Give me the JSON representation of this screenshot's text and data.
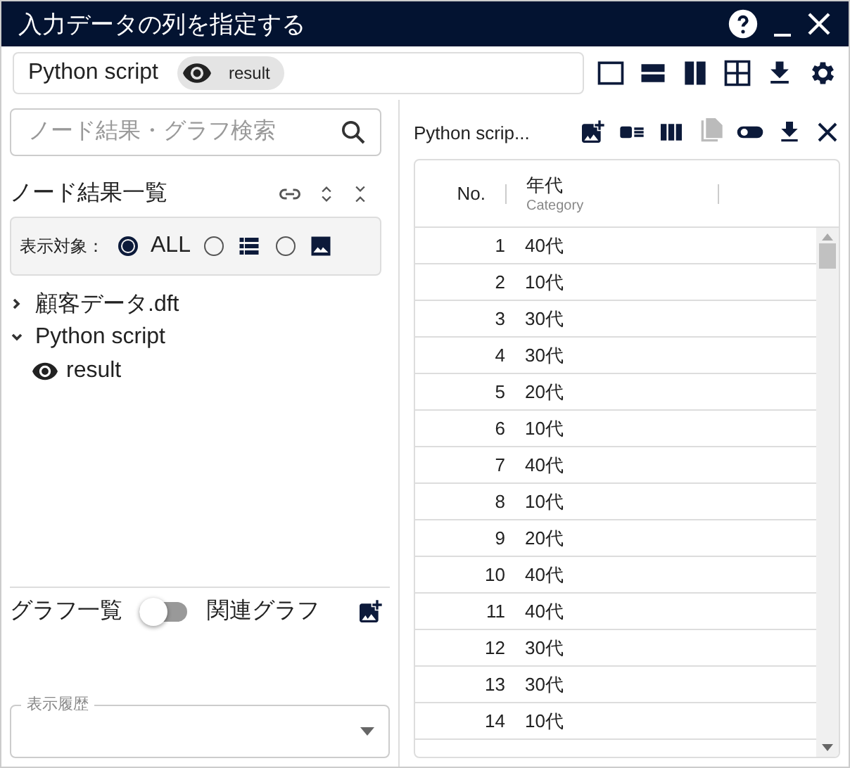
{
  "window": {
    "title": "入力データの列を指定する"
  },
  "toolbar": {
    "node": "Python script",
    "output": "result"
  },
  "left": {
    "search": {
      "placeholder": "ノード結果・グラフ検索"
    },
    "node_list": {
      "title": "ノード結果一覧"
    },
    "filter": {
      "label": "表示対象：",
      "options": [
        {
          "kind": "text",
          "label": "ALL",
          "selected": true
        },
        {
          "kind": "table",
          "selected": false
        },
        {
          "kind": "image",
          "selected": false
        }
      ]
    },
    "tree": [
      {
        "label": "顧客データ.dft",
        "expanded": false
      },
      {
        "label": "Python script",
        "expanded": true,
        "children": [
          {
            "label": "result"
          }
        ]
      }
    ],
    "graphs": {
      "left_label": "グラフ一覧",
      "right_label": "関連グラフ",
      "on": false
    },
    "history": {
      "label": "表示履歴"
    }
  },
  "right": {
    "title": "Python scrip...",
    "table": {
      "columns": [
        {
          "label": "No."
        },
        {
          "label": "年代",
          "sublabel": "Category"
        }
      ],
      "rows": [
        [
          "1",
          "40代"
        ],
        [
          "2",
          "10代"
        ],
        [
          "3",
          "30代"
        ],
        [
          "4",
          "30代"
        ],
        [
          "5",
          "20代"
        ],
        [
          "6",
          "10代"
        ],
        [
          "7",
          "40代"
        ],
        [
          "8",
          "10代"
        ],
        [
          "9",
          "20代"
        ],
        [
          "10",
          "40代"
        ],
        [
          "11",
          "40代"
        ],
        [
          "12",
          "30代"
        ],
        [
          "13",
          "30代"
        ],
        [
          "14",
          "10代"
        ]
      ]
    }
  }
}
